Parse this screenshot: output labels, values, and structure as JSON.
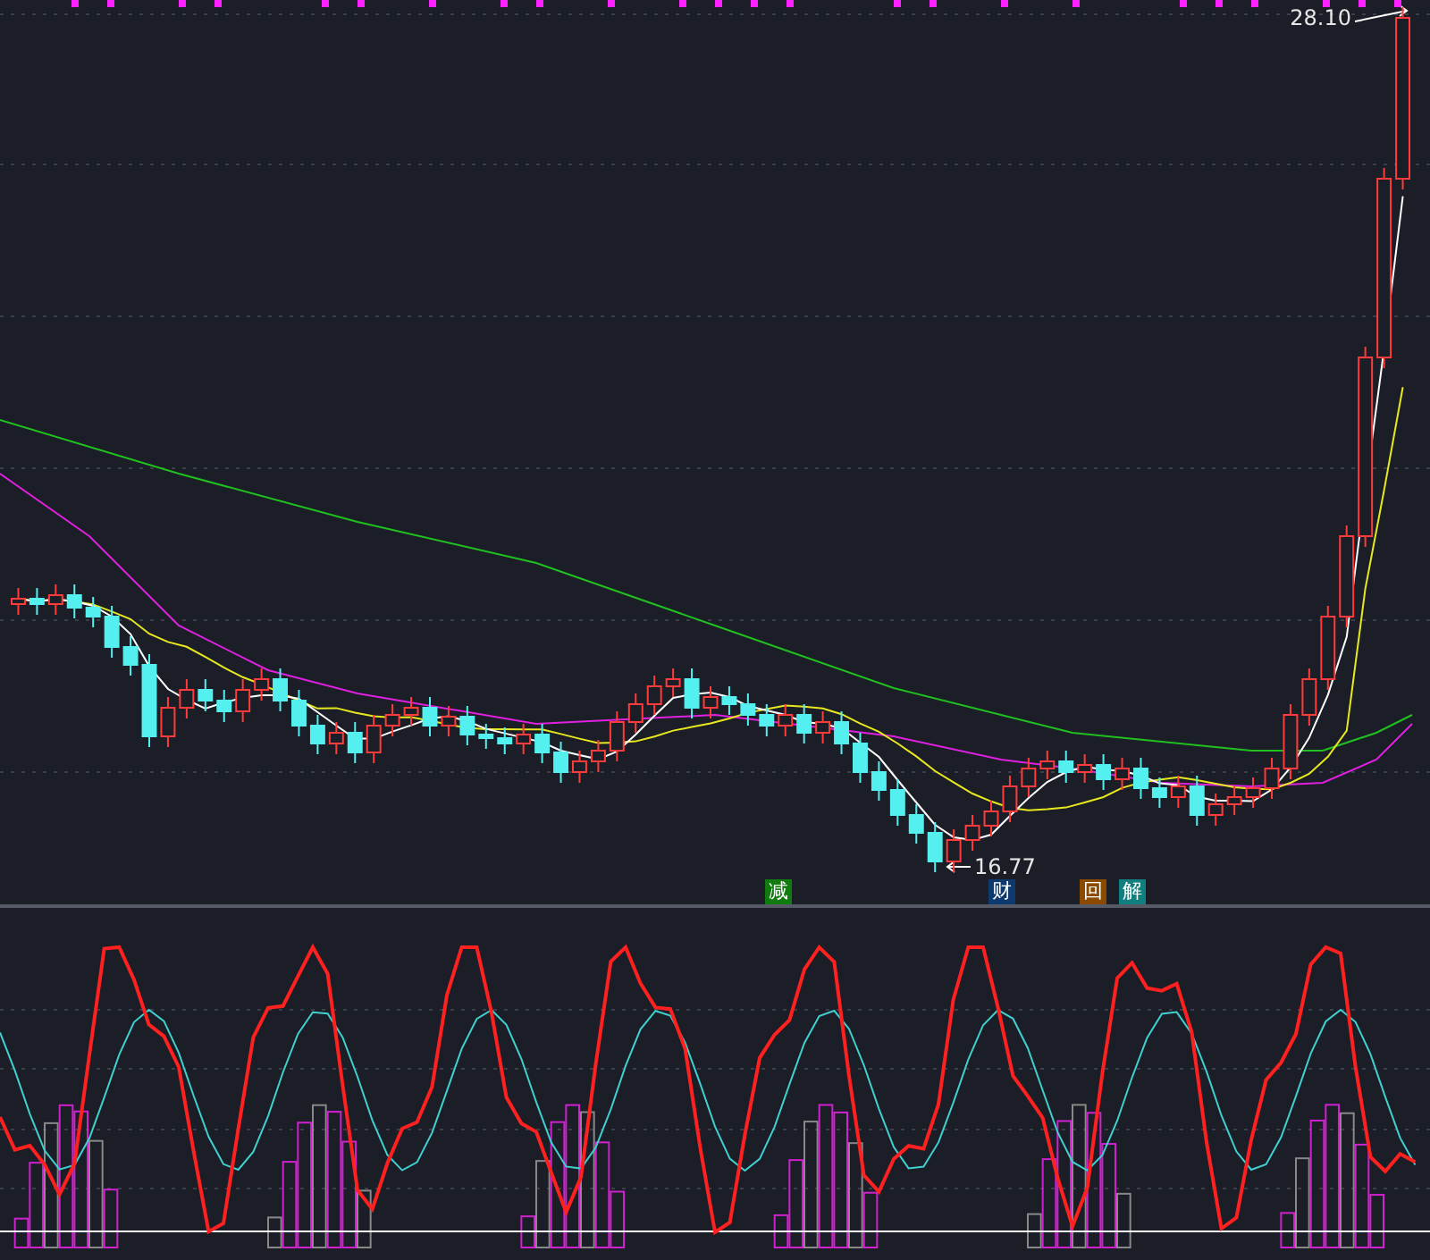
{
  "price_labels": [
    {
      "kind": "high",
      "text": "28.10"
    },
    {
      "kind": "low",
      "text": "16.77"
    }
  ],
  "signals": [
    {
      "text": "减",
      "color": "#107c10"
    },
    {
      "text": "财",
      "color": "#0d3a6e"
    },
    {
      "text": "回",
      "color": "#8a4a00"
    },
    {
      "text": "解",
      "color": "#0f7f7f"
    }
  ]
}
